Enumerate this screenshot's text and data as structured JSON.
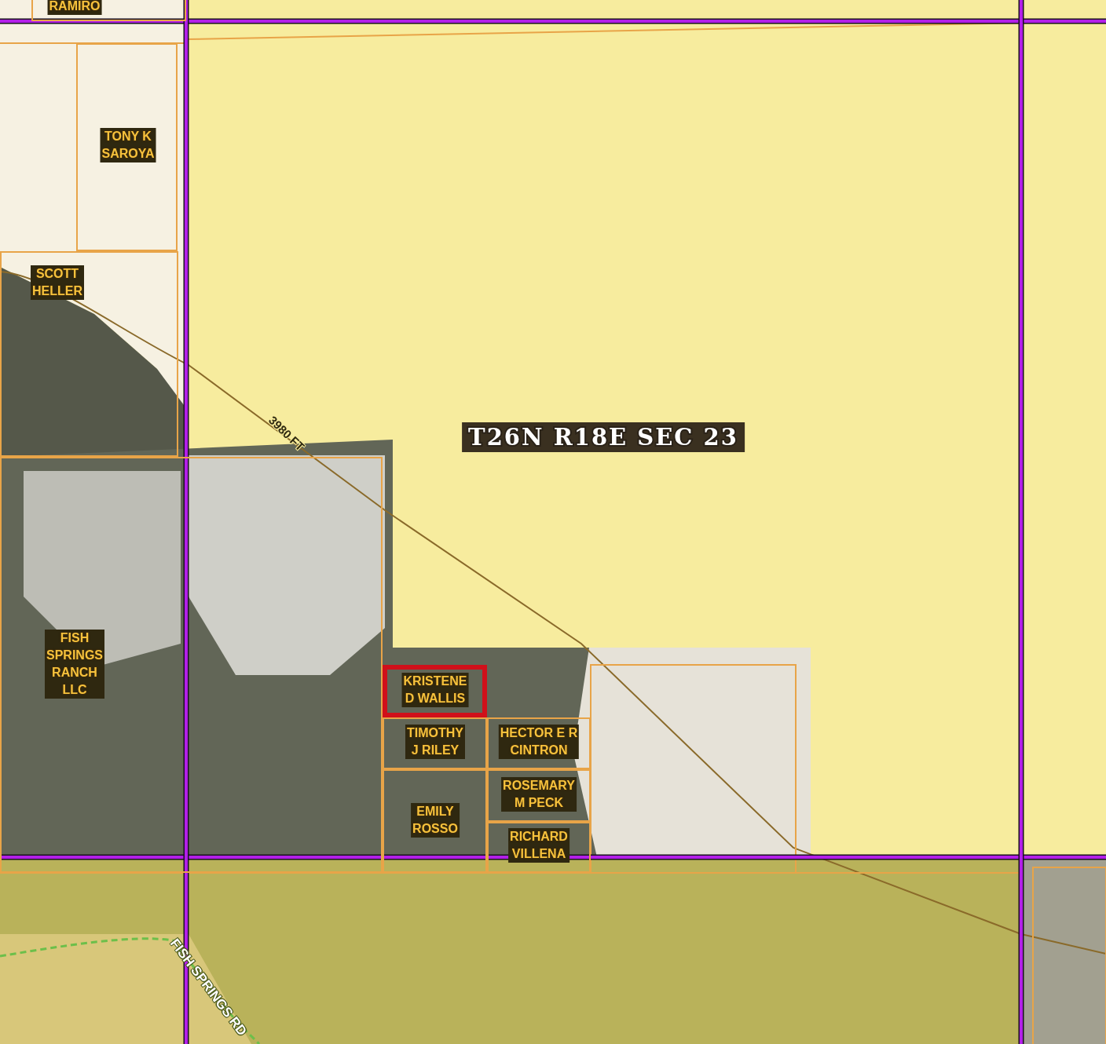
{
  "section_label": "T26N R18E SEC 23",
  "contour_label": "3980 FT",
  "road_label": "FISH SPRINGS RD",
  "parcels": [
    {
      "owner": "RAMIRO",
      "selected": false
    },
    {
      "owner": "TONY K\nSAROYA",
      "selected": false
    },
    {
      "owner": "SCOTT\nHELLER",
      "selected": false
    },
    {
      "owner": "FISH\nSPRINGS\nRANCH\nLLC",
      "selected": false
    },
    {
      "owner": "KRISTENE\nD WALLIS",
      "selected": true
    },
    {
      "owner": "TIMOTHY\nJ RILEY",
      "selected": false
    },
    {
      "owner": "HECTOR E R\nCINTRON",
      "selected": false
    },
    {
      "owner": "EMILY\nROSSO",
      "selected": false
    },
    {
      "owner": "ROSEMARY\nM PECK",
      "selected": false
    },
    {
      "owner": "RICHARD\nVILLENA",
      "selected": false
    }
  ]
}
